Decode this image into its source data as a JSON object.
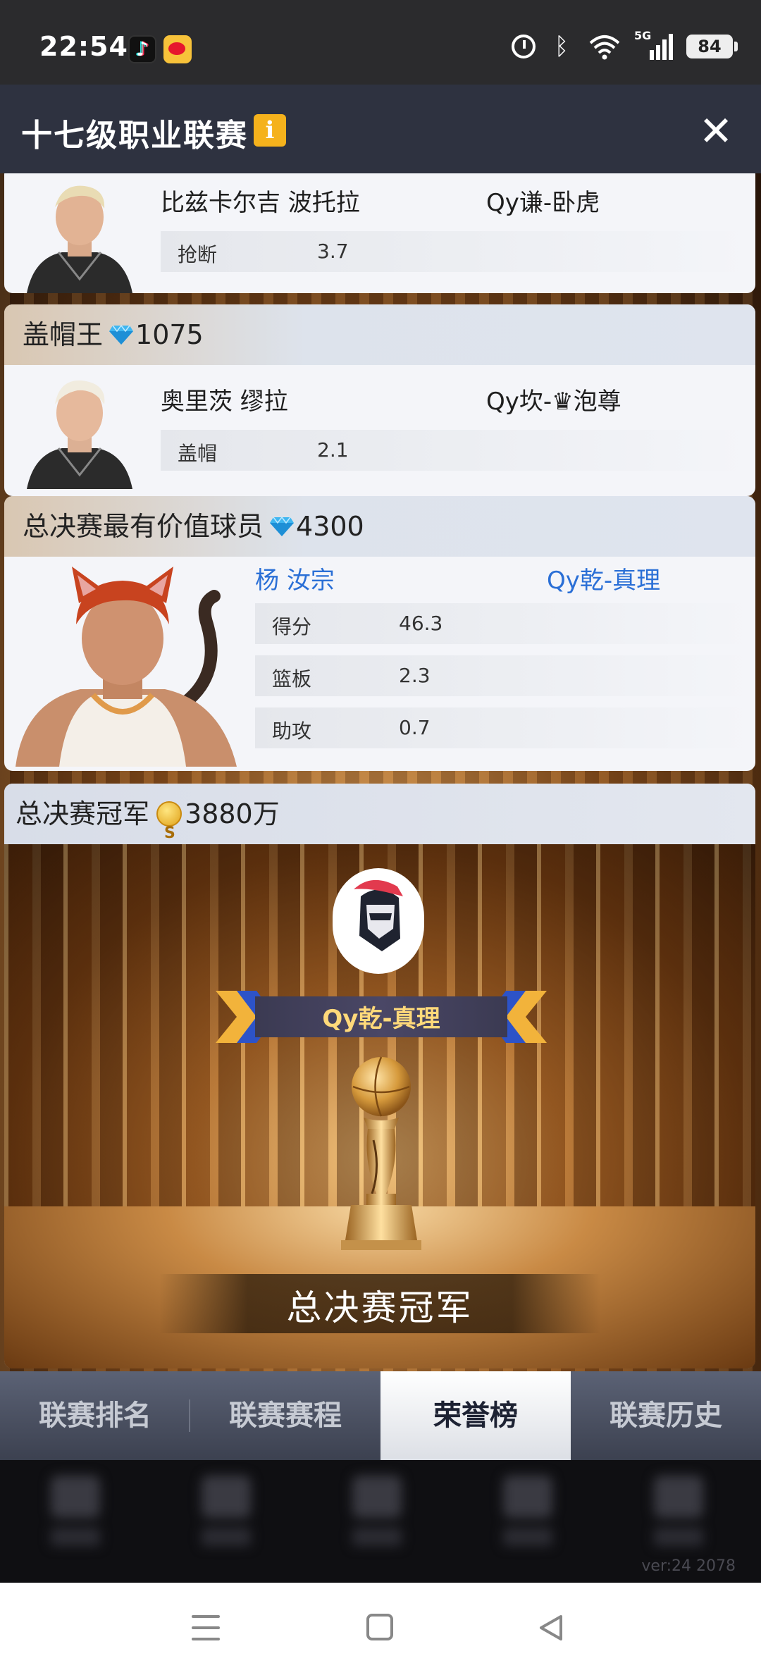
{
  "status_bar": {
    "time": "22:54",
    "network": "5G",
    "battery": "84"
  },
  "header": {
    "title": "十七级职业联赛",
    "info_label": "i",
    "close_label": "✕"
  },
  "steals_card": {
    "player_name": "比兹卡尔吉 波托拉",
    "team": "Qy谦-卧虎",
    "stat_label": "抢断",
    "stat_value": "3.7"
  },
  "blocks_card": {
    "title": "盖帽王",
    "reward": "1075",
    "player_name": "奥里茨 缪拉",
    "team": "Qy坎-♛泡尊",
    "stat_label": "盖帽",
    "stat_value": "2.1"
  },
  "mvp_card": {
    "title": "总决赛最有价值球员",
    "reward": "4300",
    "player_name": "杨 汝宗",
    "team": "Qy乾-真理",
    "stats": [
      {
        "label": "得分",
        "value": "46.3"
      },
      {
        "label": "篮板",
        "value": "2.3"
      },
      {
        "label": "助攻",
        "value": "0.7"
      }
    ]
  },
  "champion_card": {
    "title": "总决赛冠军",
    "reward": "3880万",
    "team": "Qy乾-真理",
    "caption": "总决赛冠军"
  },
  "tabs": [
    {
      "label": "联赛排名",
      "active": false
    },
    {
      "label": "联赛赛程",
      "active": false
    },
    {
      "label": "荣誉榜",
      "active": true
    },
    {
      "label": "联赛历史",
      "active": false
    }
  ],
  "version": "ver:24  2078",
  "colors": {
    "accent_blue": "#2a6fd6",
    "gold": "#ffd97a",
    "header_bg": "#2e3240"
  },
  "icons": [
    "tiktok-icon",
    "weibo-icon",
    "alarm-icon",
    "bluetooth-icon",
    "wifi-icon",
    "signal-icon",
    "diamond-icon",
    "coin-icon",
    "trophy-icon"
  ]
}
